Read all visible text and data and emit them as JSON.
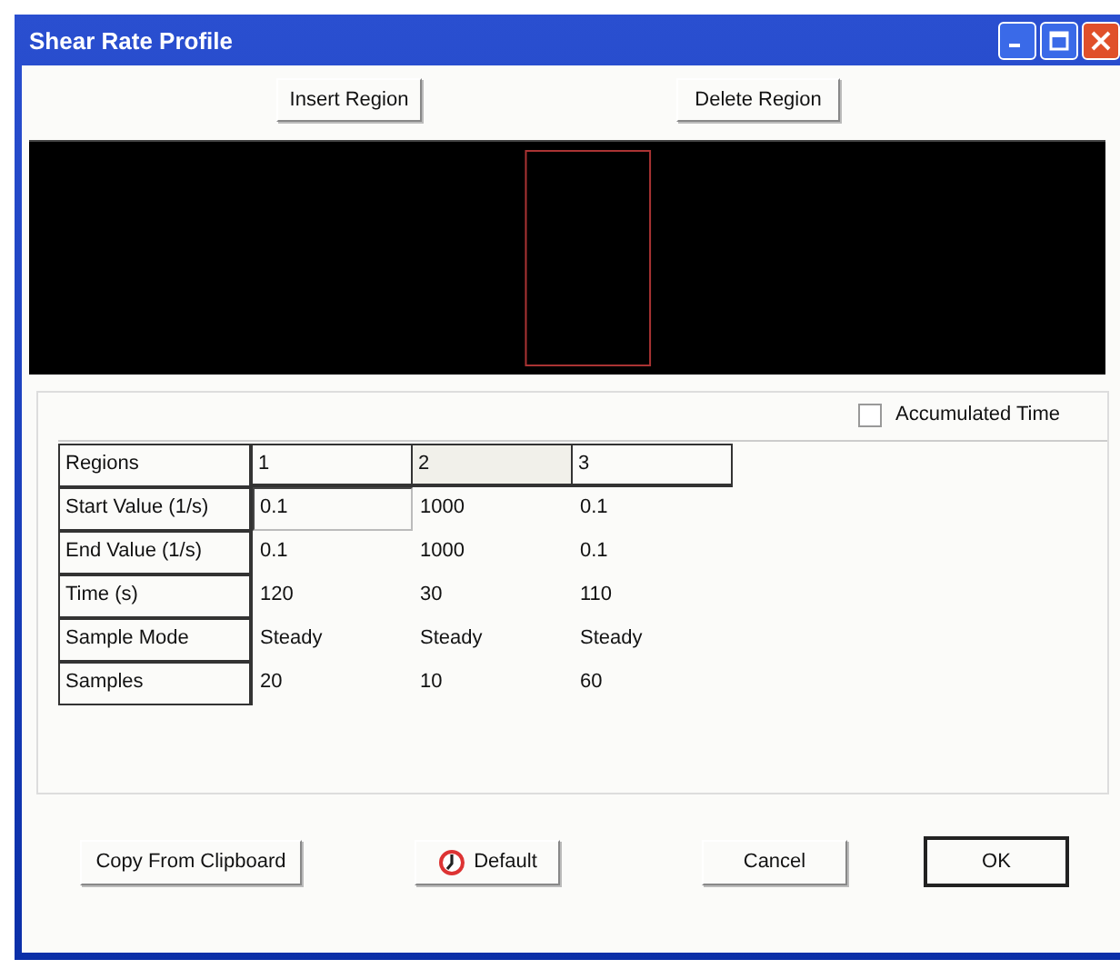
{
  "window": {
    "title": "Shear Rate Profile"
  },
  "toolbar": [
    "Insert Region",
    "Delete Region"
  ],
  "accumulated_time": {
    "label": "Accumulated Time",
    "checked": false
  },
  "table": {
    "header": "Regions",
    "regions": [
      {
        "label": "1",
        "selected": false
      },
      {
        "label": "2",
        "selected": true
      },
      {
        "label": "3",
        "selected": false
      }
    ],
    "rows": [
      {
        "label": "Start Value (1/s)",
        "cells": [
          {
            "value": "0.1",
            "selected": true
          },
          {
            "value": "1000",
            "selected": false
          },
          {
            "value": "0.1",
            "selected": false
          }
        ]
      },
      {
        "label": "End Value (1/s)",
        "cells": [
          {
            "value": "0.1",
            "selected": false
          },
          {
            "value": "1000",
            "selected": false
          },
          {
            "value": "0.1",
            "selected": false
          }
        ]
      },
      {
        "label": "Time (s)",
        "cells": [
          {
            "value": "120",
            "selected": false
          },
          {
            "value": "30",
            "selected": false
          },
          {
            "value": "110",
            "selected": false
          }
        ]
      },
      {
        "label": "Sample Mode",
        "cells": [
          {
            "value": "Steady",
            "selected": false
          },
          {
            "value": "Steady",
            "selected": false
          },
          {
            "value": "Steady",
            "selected": false
          }
        ]
      },
      {
        "label": "Samples",
        "cells": [
          {
            "value": "20",
            "selected": false
          },
          {
            "value": "10",
            "selected": false
          },
          {
            "value": "60",
            "selected": false
          }
        ]
      }
    ]
  },
  "buttons": [
    {
      "label": "Copy From Clipboard",
      "kind": "plain"
    },
    {
      "label": "Default",
      "kind": "icon"
    },
    {
      "label": "Cancel",
      "kind": "plain"
    },
    {
      "label": "OK",
      "kind": "default"
    }
  ]
}
